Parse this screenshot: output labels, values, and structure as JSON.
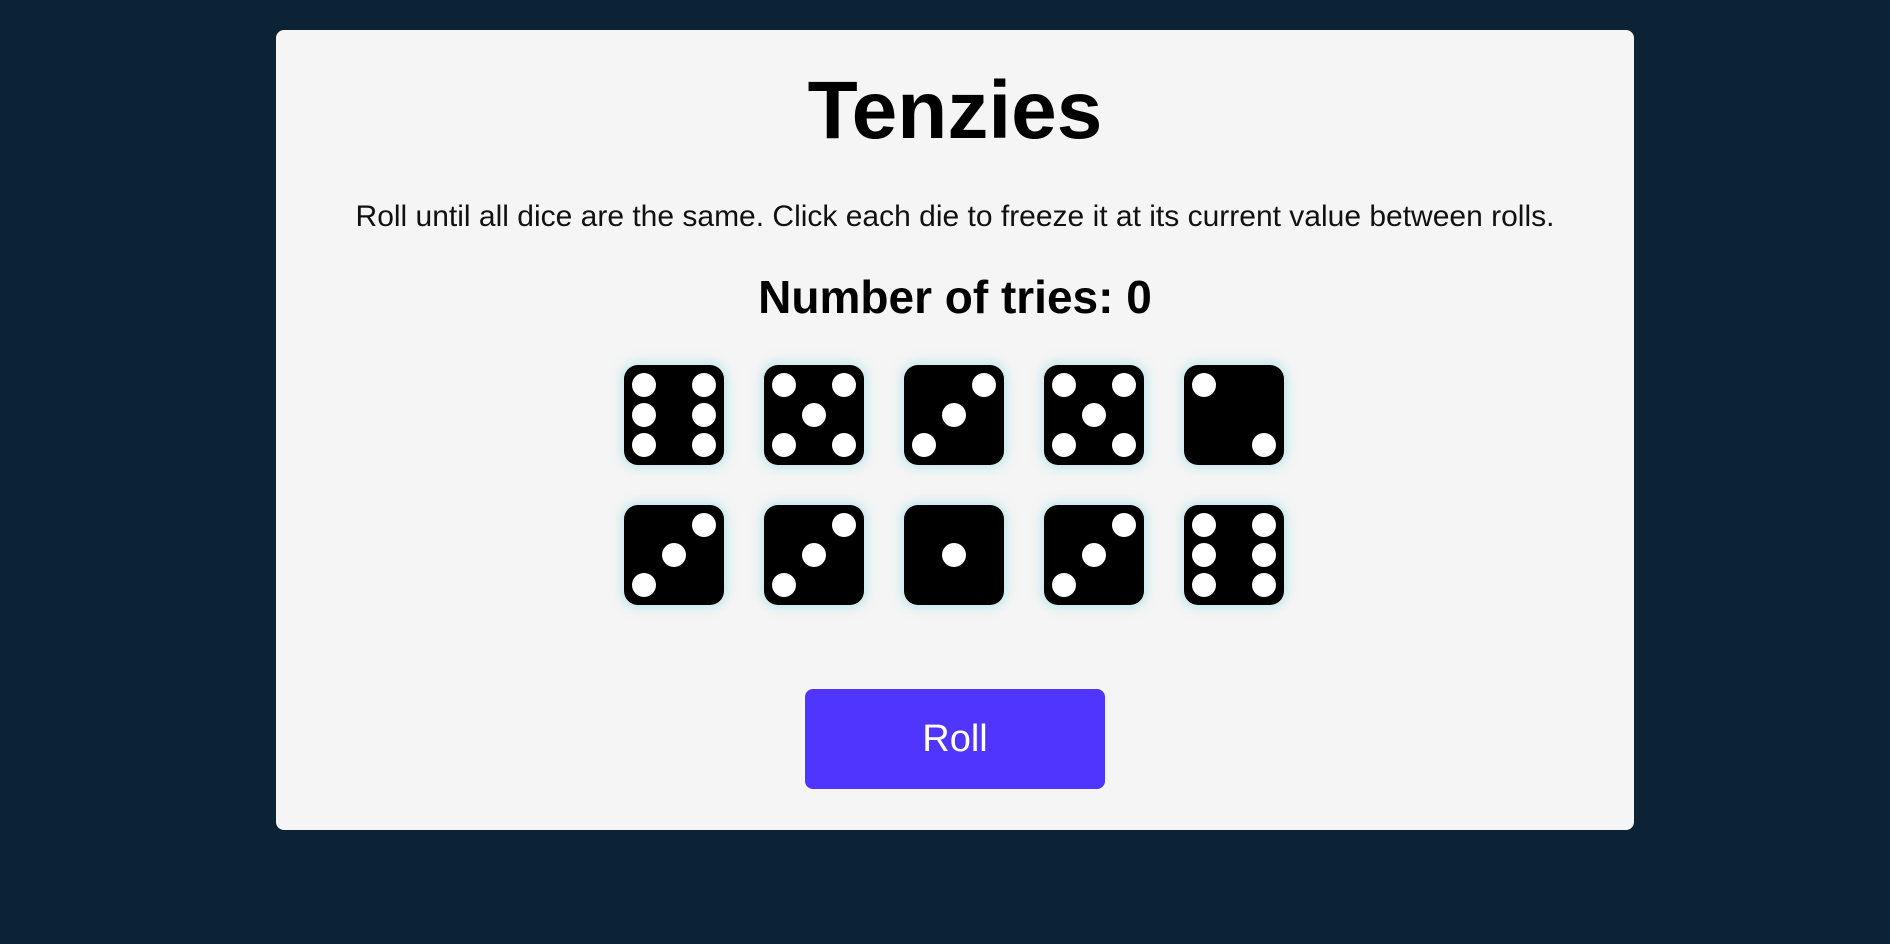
{
  "game": {
    "title": "Tenzies",
    "instructions": "Roll until all dice are the same. Click each die to freeze it at its current value between rolls.",
    "tries_label": "Number of tries: 0",
    "tries_count": 0
  },
  "dice": [
    {
      "value": 6,
      "held": false
    },
    {
      "value": 5,
      "held": false
    },
    {
      "value": 3,
      "held": false
    },
    {
      "value": 5,
      "held": false
    },
    {
      "value": 2,
      "held": false
    },
    {
      "value": 3,
      "held": false
    },
    {
      "value": 3,
      "held": false
    },
    {
      "value": 1,
      "held": false
    },
    {
      "value": 3,
      "held": false
    },
    {
      "value": 6,
      "held": false
    }
  ],
  "controls": {
    "roll_label": "Roll",
    "roll_color": "#5035ff"
  },
  "colors": {
    "background": "#0b2335",
    "card": "#f5f5f5",
    "die_face": "#000000",
    "pip": "#ffffff"
  }
}
